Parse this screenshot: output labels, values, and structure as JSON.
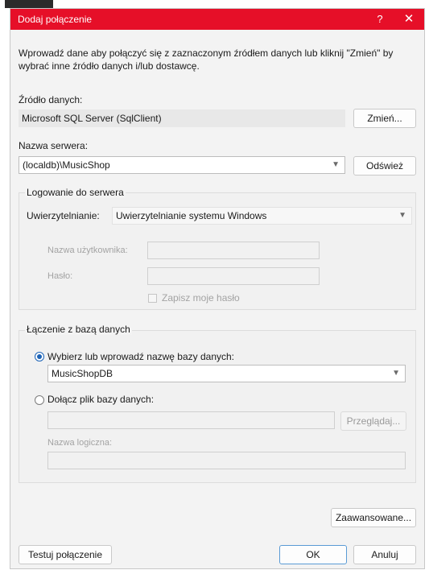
{
  "dialog": {
    "title": "Dodaj połączenie",
    "help_glyph": "?",
    "close_glyph": "✕",
    "intro": "Wprowadź dane aby połączyć się z zaznaczonym źródłem danych lub kliknij \"Zmień\" by wybrać inne źródło danych i/lub dostawcę.",
    "accent_color": "#e60f28"
  },
  "data_source": {
    "label": "Źródło danych:",
    "value": "Microsoft SQL Server (SqlClient)",
    "change_button": "Zmień..."
  },
  "server": {
    "label": "Nazwa serwera:",
    "value": "(localdb)\\MusicShop",
    "refresh_button": "Odśwież"
  },
  "login": {
    "group_title": "Logowanie do serwera",
    "auth_label": "Uwierzytelnianie:",
    "auth_value": "Uwierzytelnianie systemu Windows",
    "username_label": "Nazwa użytkownika:",
    "username_value": "",
    "password_label": "Hasło:",
    "password_value": "",
    "save_password_label": "Zapisz moje hasło"
  },
  "database": {
    "group_title": "Łączenie z bazą danych",
    "select_option_label": "Wybierz lub wprowadź nazwę bazy danych:",
    "select_value": "MusicShopDB",
    "attach_option_label": "Dołącz plik bazy danych:",
    "attach_value": "",
    "browse_button": "Przeglądaj...",
    "logical_name_label": "Nazwa logiczna:",
    "logical_name_value": ""
  },
  "footer": {
    "advanced_button": "Zaawansowane...",
    "test_button": "Testuj połączenie",
    "ok_button": "OK",
    "cancel_button": "Anuluj"
  },
  "icons": {
    "chevron": "chevron-down-icon",
    "close": "close-icon",
    "help": "help-icon"
  }
}
